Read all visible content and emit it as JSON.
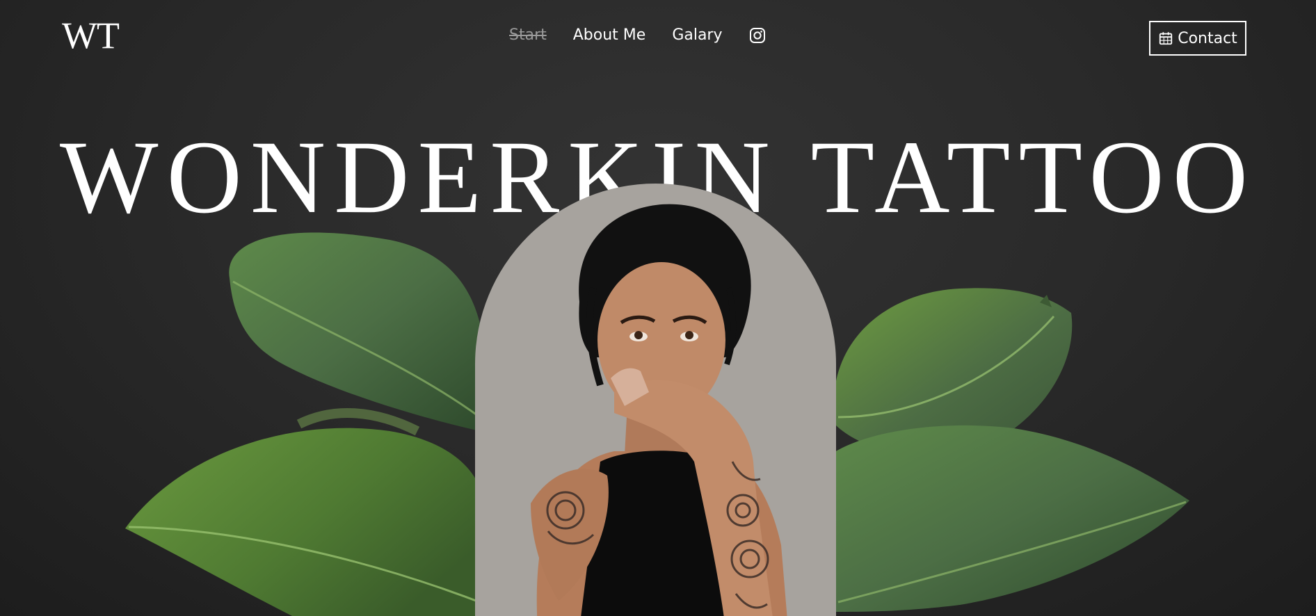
{
  "header": {
    "logo": "WT",
    "nav": [
      {
        "label": "Start",
        "active": true
      },
      {
        "label": "About Me",
        "active": false
      },
      {
        "label": "Galary",
        "active": false
      }
    ],
    "instagram_icon": "instagram-icon",
    "contact": {
      "icon": "calendar-icon",
      "label": "Contact"
    }
  },
  "hero": {
    "title": "WONDERKIN TATTOO",
    "portrait": "tattooed woman covering mouth with hand",
    "decor": "green rubber plant leaves"
  },
  "colors": {
    "background": "#2a2a2a",
    "text": "#ffffff",
    "active_nav": "#9a9a9a",
    "arch": "#a7a39e",
    "leaf": "#4f7a3e"
  }
}
